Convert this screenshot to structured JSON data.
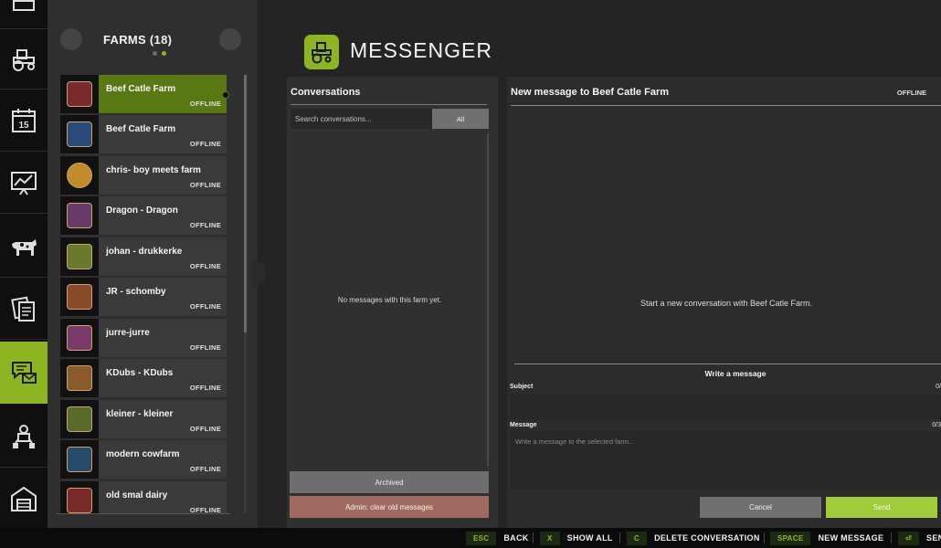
{
  "rail": {
    "items": [
      {
        "icon": "tractor-icon"
      },
      {
        "icon": "calendar-icon",
        "day": "15"
      },
      {
        "icon": "chart-icon"
      },
      {
        "icon": "cow-icon"
      },
      {
        "icon": "contracts-icon"
      },
      {
        "icon": "messenger-icon",
        "active": true
      },
      {
        "icon": "production-icon"
      },
      {
        "icon": "garage-icon"
      }
    ]
  },
  "farms": {
    "title": "FARMS (18)",
    "list": [
      {
        "name": "Beef Catle Farm",
        "status": "OFFLINE",
        "selected": true,
        "badge_color": "#7a2a2a"
      },
      {
        "name": "Beef Catle Farm",
        "status": "OFFLINE",
        "badge_color": "#2a4a7a"
      },
      {
        "name": "chris- boy meets farm",
        "status": "OFFLINE",
        "badge_color": "#c28a2a"
      },
      {
        "name": "Dragon - Dragon",
        "status": "OFFLINE",
        "badge_color": "#6a3a6a"
      },
      {
        "name": "johan - drukkerke",
        "status": "OFFLINE",
        "badge_color": "#6a7a2a"
      },
      {
        "name": "JR - schomby",
        "status": "OFFLINE",
        "badge_color": "#8a4a2a"
      },
      {
        "name": "jurre-jurre",
        "status": "OFFLINE",
        "badge_color": "#7a3a6a"
      },
      {
        "name": "KDubs - KDubs",
        "status": "OFFLINE",
        "badge_color": "#8a5a2a"
      },
      {
        "name": "kleiner - kleiner",
        "status": "OFFLINE",
        "badge_color": "#5a6a2a"
      },
      {
        "name": "modern cowfarm",
        "status": "OFFLINE",
        "badge_color": "#2a4a6a"
      },
      {
        "name": "old smal dairy",
        "status": "OFFLINE",
        "badge_color": "#7a2a2a"
      }
    ]
  },
  "messenger": {
    "title": "MESSENGER"
  },
  "conversations": {
    "title": "Conversations",
    "search_placeholder": "Search conversations...",
    "filter_label": "All",
    "empty_text": "No messages with this farm yet.",
    "archived_label": "Archived",
    "admin_label": "Admin: clear old messages"
  },
  "new_message": {
    "title": "New message to Beef Catle Farm",
    "status": "OFFLINE",
    "empty_text": "Start a new conversation with Beef Catle Farm.",
    "write_title": "Write a message",
    "subject_label": "Subject",
    "subject_count": "0/",
    "message_label": "Message",
    "message_count": "0/3",
    "message_placeholder": "Write a message to the selected farm...",
    "cancel_label": "Cancel",
    "send_label": "Send"
  },
  "hints": [
    {
      "key": "ESC",
      "label": "BACK"
    },
    {
      "key": "X",
      "label": "SHOW ALL"
    },
    {
      "key": "C",
      "label": "DELETE CONVERSATION"
    },
    {
      "key": "SPACE",
      "label": "NEW MESSAGE"
    },
    {
      "key": "⏎",
      "label": "SEN"
    }
  ],
  "colors": {
    "accent": "#8cb521",
    "selected": "#587814",
    "danger": "#a06a60"
  }
}
